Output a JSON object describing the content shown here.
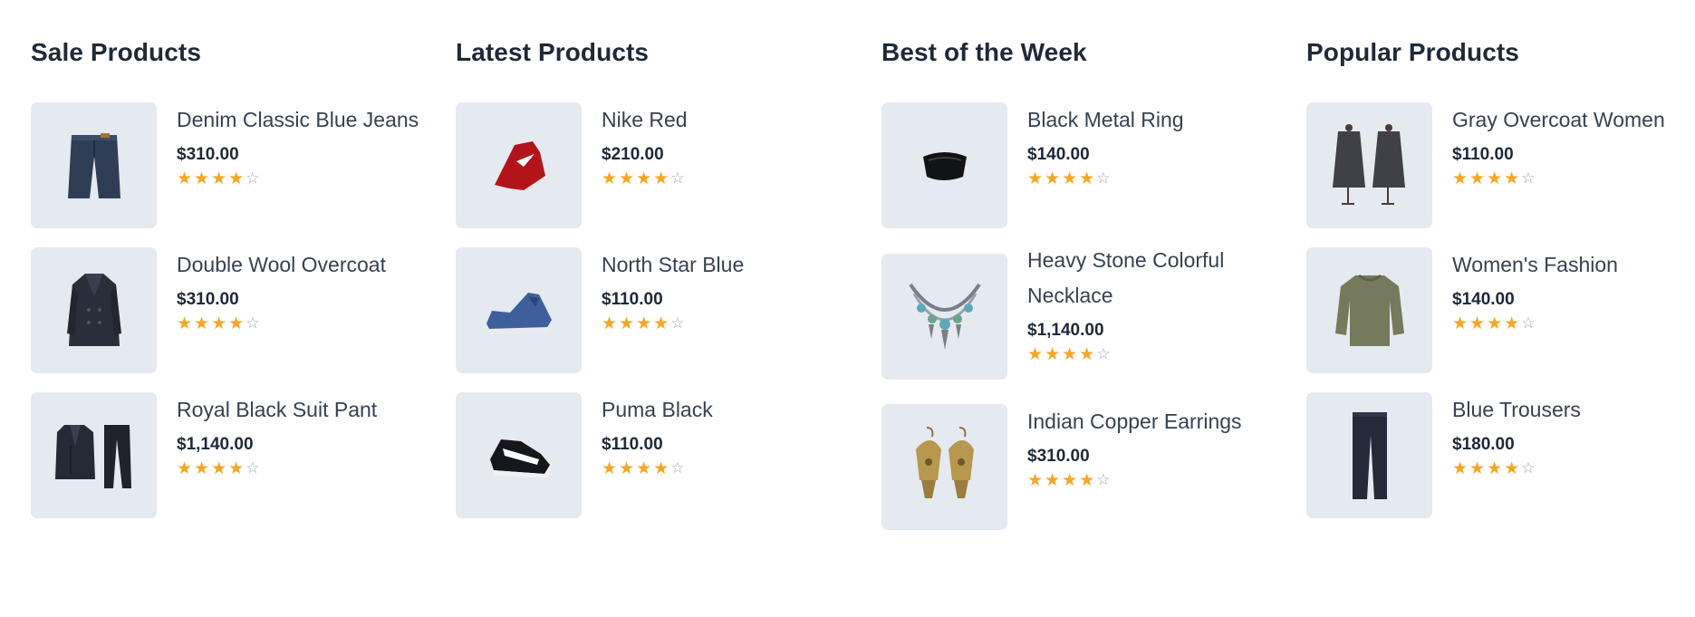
{
  "sections": [
    {
      "title": "Sale Products",
      "items": [
        {
          "name": "Denim Classic Blue Jeans",
          "price": "$310.00",
          "rating": 4,
          "icon": "jeans-icon"
        },
        {
          "name": "Double Wool Overcoat",
          "price": "$310.00",
          "rating": 4,
          "icon": "overcoat-icon"
        },
        {
          "name": "Royal Black Suit Pant",
          "price": "$1,140.00",
          "rating": 4,
          "icon": "suit-icon"
        }
      ]
    },
    {
      "title": "Latest Products",
      "items": [
        {
          "name": "Nike Red",
          "price": "$210.00",
          "rating": 4,
          "icon": "red-sneaker-icon"
        },
        {
          "name": "North Star Blue",
          "price": "$110.00",
          "rating": 4,
          "icon": "blue-sneaker-icon"
        },
        {
          "name": "Puma Black",
          "price": "$110.00",
          "rating": 4,
          "icon": "black-sneaker-icon"
        }
      ]
    },
    {
      "title": "Best of the Week",
      "items": [
        {
          "name": "Black Metal Ring",
          "price": "$140.00",
          "rating": 4,
          "icon": "ring-icon"
        },
        {
          "name": "Heavy Stone Colorful Necklace",
          "price": "$1,140.00",
          "rating": 4,
          "icon": "necklace-icon"
        },
        {
          "name": "Indian Copper Earrings",
          "price": "$310.00",
          "rating": 4,
          "icon": "earrings-icon"
        }
      ]
    },
    {
      "title": "Popular Products",
      "items": [
        {
          "name": "Gray Overcoat Women",
          "price": "$110.00",
          "rating": 4,
          "icon": "women-overcoat-icon"
        },
        {
          "name": "Women's Fashion",
          "price": "$140.00",
          "rating": 4,
          "icon": "sweater-icon"
        },
        {
          "name": "Blue Trousers",
          "price": "$180.00",
          "rating": 4,
          "icon": "trousers-icon"
        }
      ]
    }
  ],
  "rating_max": 5,
  "colors": {
    "heading": "#1f2937",
    "text": "#374151",
    "thumb_bg": "#e5e9f0",
    "star_filled": "#f5a623",
    "star_empty": "#9ca3af"
  }
}
